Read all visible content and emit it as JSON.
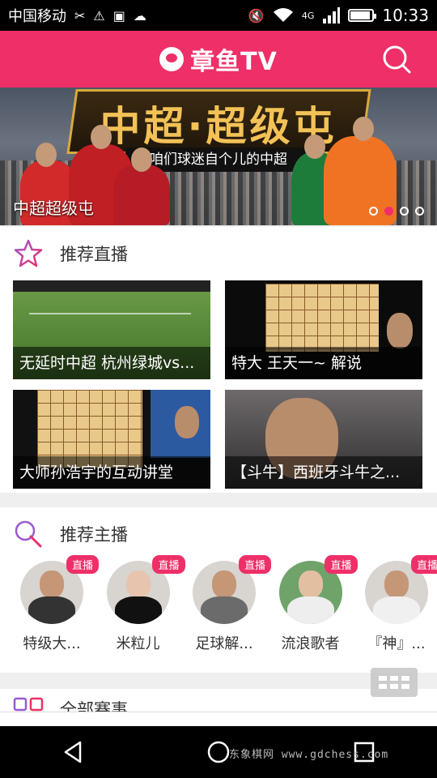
{
  "status_bar": {
    "carrier": "中国移动",
    "network": "4G",
    "time": "10:33",
    "battery_level": 0.85
  },
  "header": {
    "logo_text": "章鱼TV",
    "search_icon": "search-icon",
    "brand_color": "#ee2f68"
  },
  "banner": {
    "title": "中超·超级屯",
    "subtitle": "咱们球迷自个儿的中超",
    "caption": "中超超级屯",
    "page_count": 4,
    "active_page": 2
  },
  "recommended_live": {
    "title": "推荐直播",
    "icon": "star-icon",
    "items": [
      {
        "caption": "无延时中超 杭州绿城vs..."
      },
      {
        "caption": "特大 王天一~ 解说"
      },
      {
        "caption": "大师孙浩宇的互动讲堂"
      },
      {
        "caption": "【斗牛】西班牙斗牛之..."
      }
    ]
  },
  "recommended_anchors": {
    "title": "推荐主播",
    "icon": "pen-icon",
    "badge_label": "直播",
    "items": [
      {
        "name": "特级大..."
      },
      {
        "name": "米粒儿"
      },
      {
        "name": "足球解..."
      },
      {
        "name": "流浪歌者"
      },
      {
        "name": "『神』..."
      }
    ]
  },
  "all_events": {
    "title": "全部赛事"
  },
  "watermark": "东象棋网 www.gdchess.com"
}
